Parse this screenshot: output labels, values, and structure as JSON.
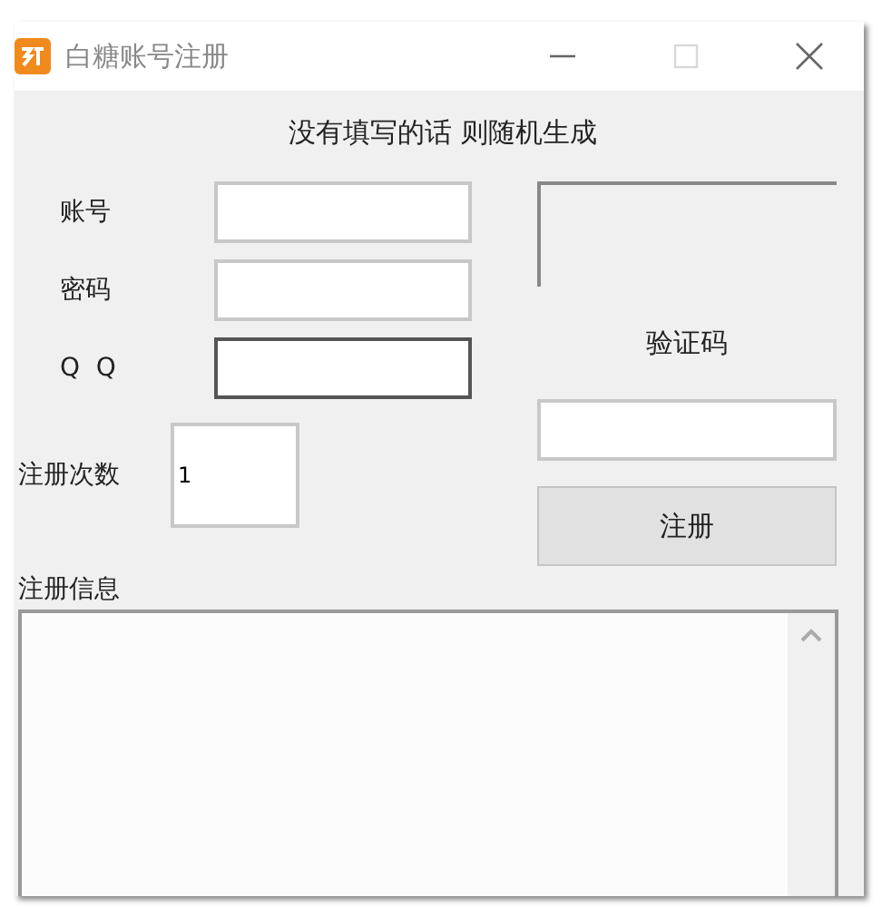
{
  "window": {
    "title": "白糖账号注册",
    "maximize_disabled": true
  },
  "heading": "没有填写的话 则随机生成",
  "fields": [
    {
      "label": "账号",
      "focused": false
    },
    {
      "label": "密码",
      "focused": false
    },
    {
      "label": "Q  Q",
      "focused": true
    }
  ],
  "count": {
    "label": "注册次数",
    "value": "1"
  },
  "captcha": {
    "label": "验证码"
  },
  "register_button": "注册",
  "info": {
    "label": "注册信息"
  }
}
